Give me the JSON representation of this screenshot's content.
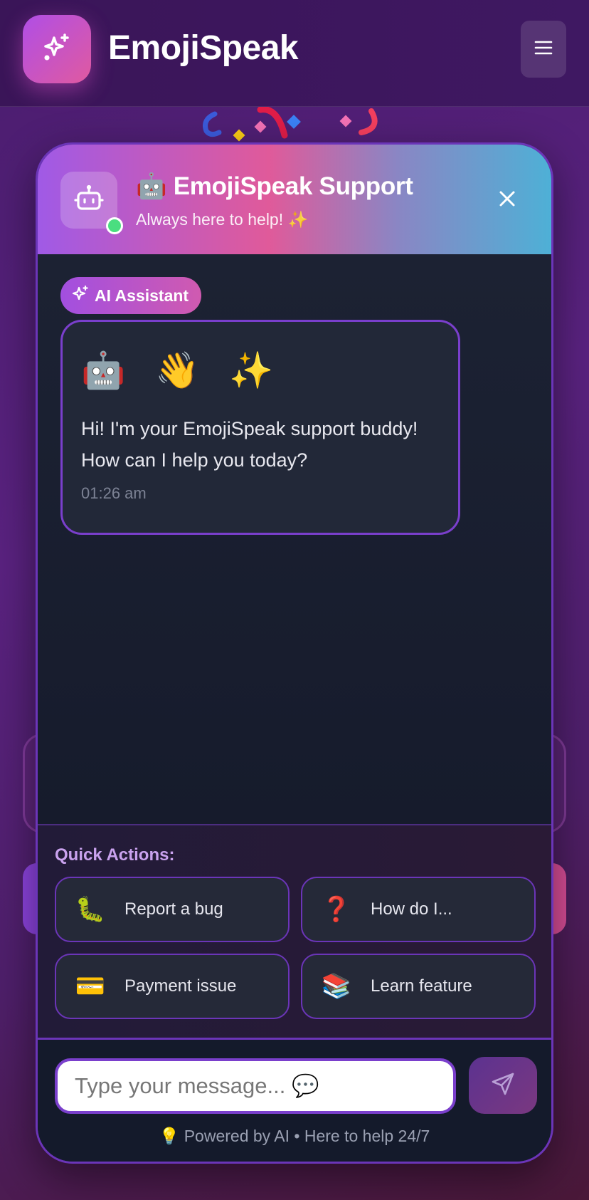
{
  "app": {
    "brand_title": "EmojiSpeak",
    "accent": "#b04ee6",
    "accent_pink": "#e05aa0"
  },
  "header": {
    "logo_icon": "sparkles-icon",
    "menu_icon": "hamburger-menu-icon"
  },
  "chat": {
    "title": "🤖 EmojiSpeak Support",
    "subtitle": "Always here to help! ✨",
    "avatar_icon": "robot-icon",
    "status": "online",
    "close_icon": "close-icon",
    "ai_badge": "AI Assistant",
    "messages": [
      {
        "sender": "AI Assistant",
        "emoji": "🤖 👋 ✨",
        "text": "Hi! I'm your EmojiSpeak support buddy! How can I help you today?",
        "time": "01:26 am"
      }
    ],
    "quick_actions_title": "Quick Actions:",
    "quick_actions": [
      {
        "icon": "🐛",
        "label": "Report a bug"
      },
      {
        "icon": "❓",
        "label": "How do I..."
      },
      {
        "icon": "💳",
        "label": "Payment issue"
      },
      {
        "icon": "📚",
        "label": "Learn feature"
      }
    ],
    "input_placeholder": "Type your message... 💬",
    "send_icon": "send-icon",
    "footer": "💡 Powered by AI • Here to help 24/7"
  }
}
